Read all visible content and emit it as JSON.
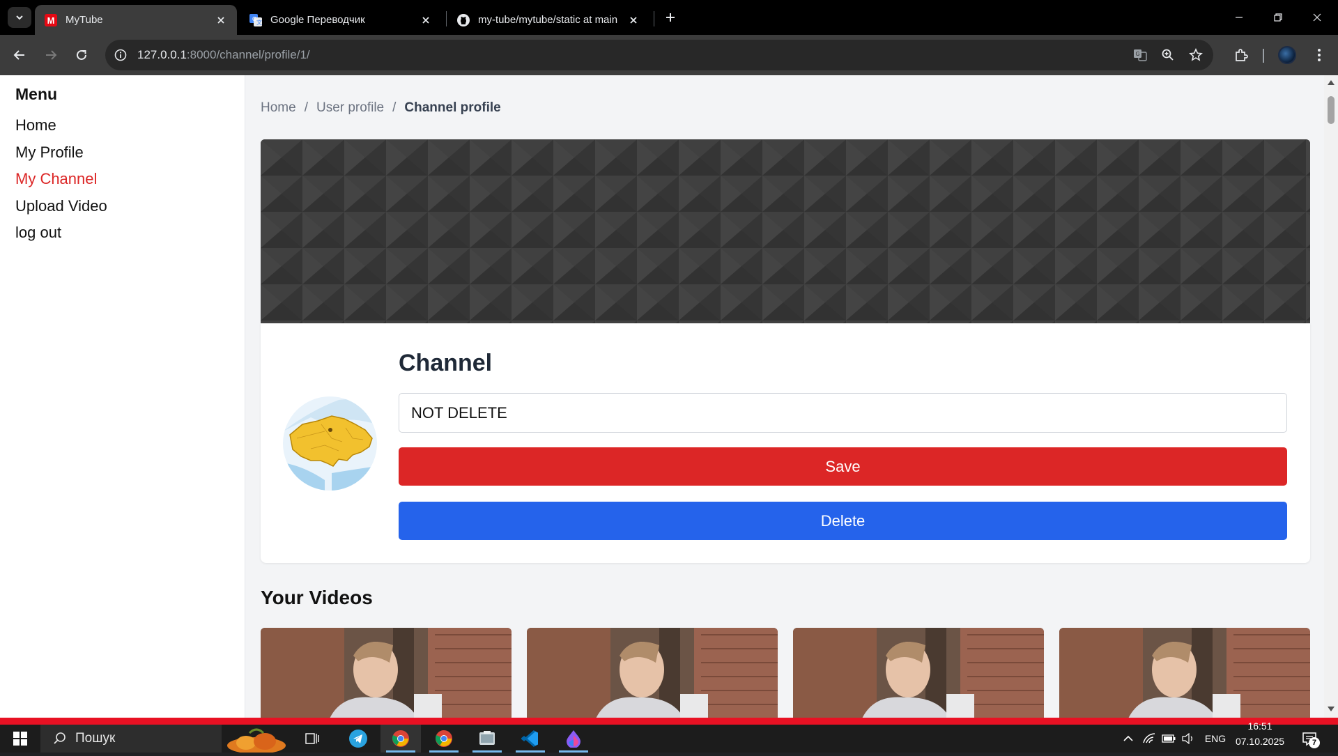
{
  "browser": {
    "tabs": [
      {
        "title": "MyTube",
        "favicon": "mytube-icon",
        "active": true
      },
      {
        "title": "Google Переводчик",
        "favicon": "google-translate-icon",
        "active": false
      },
      {
        "title": "my-tube/mytube/static at main",
        "favicon": "github-icon",
        "active": false
      }
    ],
    "url_host": "127.0.0.1",
    "url_rest": ":8000/channel/profile/1/"
  },
  "sidebar": {
    "title": "Menu",
    "items": [
      {
        "label": "Home",
        "active": false
      },
      {
        "label": "My Profile",
        "active": false
      },
      {
        "label": "My Channel",
        "active": true
      },
      {
        "label": "Upload Video",
        "active": false
      },
      {
        "label": "log out",
        "active": false
      }
    ]
  },
  "breadcrumb": {
    "items": [
      "Home",
      "User profile",
      "Channel profile"
    ],
    "separator": "/"
  },
  "channel": {
    "title": "Channel",
    "name_value": "NOT DELETE",
    "save_label": "Save",
    "delete_label": "Delete"
  },
  "videos": {
    "title": "Your Videos",
    "count_visible": 4
  },
  "taskbar": {
    "search_label": "Пошук",
    "lang": "ENG",
    "time": "16:51",
    "date": "07.10.2025",
    "notifications": "7"
  },
  "colors": {
    "accent_red": "#dc2626",
    "accent_blue": "#2563eb",
    "active_menu": "#dc2626"
  }
}
